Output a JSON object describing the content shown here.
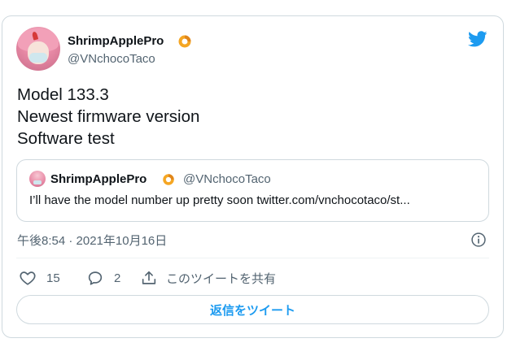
{
  "author": {
    "display_name": "ShrimpApplePro",
    "handle": "@VNchocoTaco"
  },
  "tweet": {
    "lines": [
      "Model 133.3",
      "Newest firmware version",
      "Software test"
    ]
  },
  "quoted_tweet": {
    "display_name": "ShrimpApplePro",
    "handle": "@VNchocoTaco",
    "text": "I’ll have the model number up pretty soon twitter.com/vnchocotaco/st..."
  },
  "timestamp": "午後8:54 · 2021年10月16日",
  "actions": {
    "like_count": "15",
    "reply_count": "2",
    "share_label": "このツイートを共有"
  },
  "reply_button_label": "返信をツイート",
  "colors": {
    "accent": "#1d9bf0",
    "badge": "#f5a623",
    "secondary_text": "#536471",
    "border": "#cfd9de"
  },
  "icons": [
    "twitter-bird-icon",
    "info-icon",
    "heart-icon",
    "reply-bubble-icon",
    "share-icon",
    "badge-shrimp-icon"
  ]
}
